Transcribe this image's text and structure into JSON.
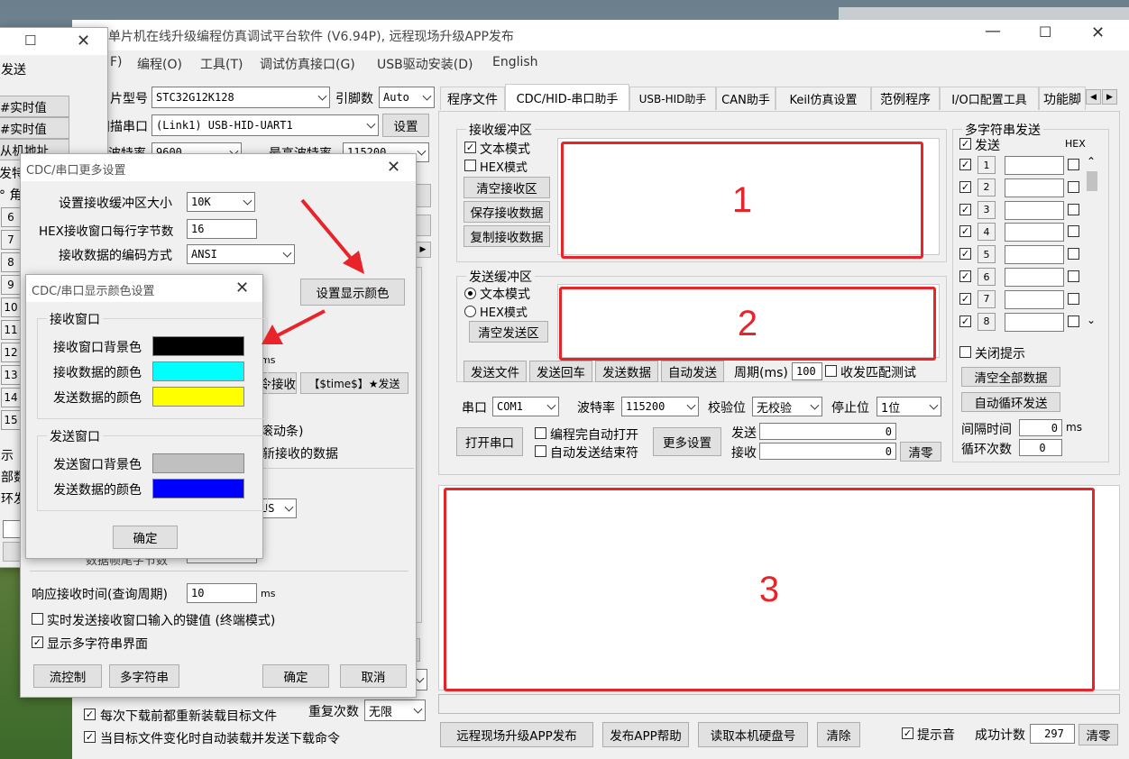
{
  "main": {
    "title": "单片机在线升级编程仿真调试平台软件 (V6.94P), 远程现场升级APP发布",
    "menu": [
      "F)",
      "编程(O)",
      "工具(T)",
      "调试仿真接口(G)",
      "USB驱动安装(D)",
      "English"
    ],
    "chip_label": "片型号",
    "chip_value": "STC32G12K128",
    "pin_label": "引脚数",
    "pin_value": "Auto",
    "port_label": "扫描串口",
    "port_value": "(Link1) USB-HID-UART1",
    "settings_button": "设置",
    "baud1_label": "波特率",
    "baud1_value": "9600",
    "maxbaud_label": "最高波特率",
    "maxbaud_value": "115200",
    "checkbox_reload": "每次下载前都重新装载目标文件",
    "checkbox_auto": "当目标文件变化时自动装载并发送下载命令",
    "repeat_label": "重复次数",
    "repeat_value": "无限",
    "bottom_buttons": [
      "远程现场升级APP发布",
      "发布APP帮助",
      "读取本机硬盘号",
      "清除"
    ],
    "sound_label": "提示音",
    "success_label": "成功计数",
    "success_value": "297",
    "clear_button": "清零"
  },
  "tabs": [
    "程序文件",
    "CDC/HID-串口助手",
    "USB-HID助手",
    "CAN助手",
    "Keil仿真设置",
    "范例程序",
    "I/O口配置工具",
    "功能脚"
  ],
  "receive": {
    "group": "接收缓冲区",
    "text_mode": "文本模式",
    "hex_mode": "HEX模式",
    "buttons": [
      "清空接收区",
      "保存接收数据",
      "复制接收数据"
    ],
    "box_label": "1"
  },
  "send": {
    "group": "发送缓冲区",
    "text_mode": "文本模式",
    "hex_mode": "HEX模式",
    "clear": "清空发送区",
    "box_label": "2",
    "row_buttons": [
      "发送文件",
      "发送回车",
      "发送数据",
      "自动发送"
    ],
    "period_label": "周期(ms)",
    "period_value": "100",
    "match_label": "收发匹配测试"
  },
  "serial": {
    "port_label": "串口",
    "port_value": "COM1",
    "baud_label": "波特率",
    "baud_value": "115200",
    "parity_label": "校验位",
    "parity_value": "无校验",
    "stop_label": "停止位",
    "stop_value": "1位",
    "open_button": "打开串口",
    "auto_open": "编程完自动打开",
    "auto_end": "自动发送结束符",
    "more_button": "更多设置",
    "send_label": "发送",
    "send_count": "0",
    "recv_label": "接收",
    "recv_count": "0",
    "zero_button": "清零"
  },
  "multi": {
    "group": "多字符串发送",
    "send_col": "发送",
    "hex_col": "HEX",
    "rows": [
      "1",
      "2",
      "3",
      "4",
      "5",
      "6",
      "7",
      "8"
    ],
    "close_tip": "关闭提示",
    "clear_all": "清空全部数据",
    "auto_loop": "自动循环发送",
    "interval_label": "间隔时间",
    "interval_value": "0",
    "interval_unit": "ms",
    "loop_label": "循环次数",
    "loop_value": "0"
  },
  "output_box_label": "3",
  "behind_win": {
    "title_fragment": "发送",
    "buttons": [
      "#实时值",
      "#实时值",
      "从机地址"
    ],
    "fragment": "发特",
    "fragment2": "° 角",
    "rows": [
      "6",
      "7",
      "8",
      "9",
      "10",
      "11",
      "12",
      "13",
      "14",
      "15"
    ],
    "left_texts": [
      "示",
      "部数",
      "环发"
    ]
  },
  "cdc_more": {
    "title": "CDC/串口更多设置",
    "buf_label": "设置接收缓冲区大小",
    "buf_value": "10K",
    "hex_bytes_label": "HEX接收窗口每行字节数",
    "hex_bytes_value": "16",
    "encoding_label": "接收数据的编码方式",
    "encoding_value": "ANSI",
    "color_button": "设置显示颜色",
    "partial_ms": "ms",
    "partial_btn1": "令接收",
    "partial_btn2": "【$time$】★发送",
    "partial_scroll": "滚动条)",
    "partial_new": "新接收的数据",
    "partial_us": "US",
    "partial_tail": "数据帧尾字节数",
    "resp_label": "响应接收时间(查询周期)",
    "resp_value": "10",
    "resp_unit": "ms",
    "realtime_label": "实时发送接收窗口输入的键值 (终端模式)",
    "show_multi_label": "显示多字符串界面",
    "buttons": [
      "流控制",
      "多字符串",
      "确定",
      "取消"
    ]
  },
  "color_dialog": {
    "title": "CDC/串口显示颜色设置",
    "recv_group": "接收窗口",
    "recv_bg": "接收窗口背景色",
    "recv_data": "接收数据的颜色",
    "send_data_in_recv": "发送数据的颜色",
    "send_group": "发送窗口",
    "send_bg": "发送窗口背景色",
    "send_data": "发送数据的颜色",
    "ok": "确定",
    "colors": {
      "recv_bg": "#000000",
      "recv_data": "#00ffff",
      "send_data_in_recv": "#ffff00",
      "send_bg": "#c0c0c0",
      "send_data": "#0000ff"
    }
  },
  "accent_red": "#e8242a"
}
